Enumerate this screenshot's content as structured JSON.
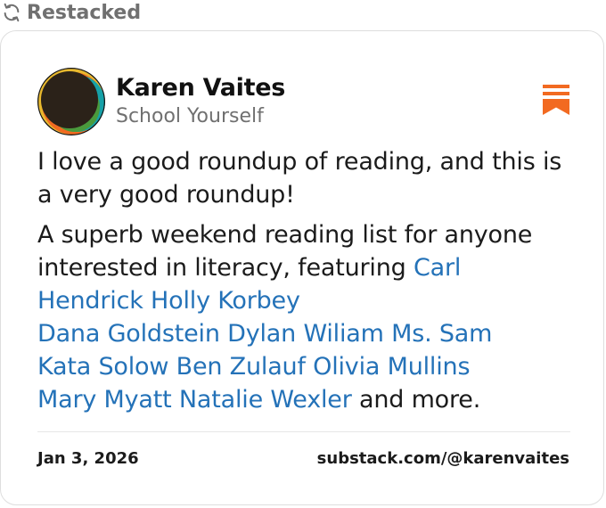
{
  "restack": {
    "icon": "restack-arrows-icon",
    "label": "Restacked"
  },
  "note": {
    "author": {
      "name": "Karen Vaites",
      "publication": "School Yourself",
      "avatar_icon": "author-avatar"
    },
    "bookmark_icon": "bookmark-icon",
    "bookmark_color": "#f26a21",
    "paragraph1": "I love a good roundup of reading, and this is a very good roundup!",
    "paragraph2_intro": "A superb weekend reading list for anyone interested in literacy, featuring",
    "mentions": [
      "Carl Hendrick",
      "Holly Korbey",
      "Dana Goldstein",
      "Dylan Wiliam",
      "Ms. Sam",
      "Kata Solow",
      "Ben Zulauf",
      "Olivia Mullins",
      "Mary Myatt",
      "Natalie Wexler"
    ],
    "paragraph2_outro": "and more.",
    "mention_color": "#2472b8"
  },
  "footer": {
    "date": "Jan 3, 2026",
    "link": "substack.com/@karenvaites"
  }
}
